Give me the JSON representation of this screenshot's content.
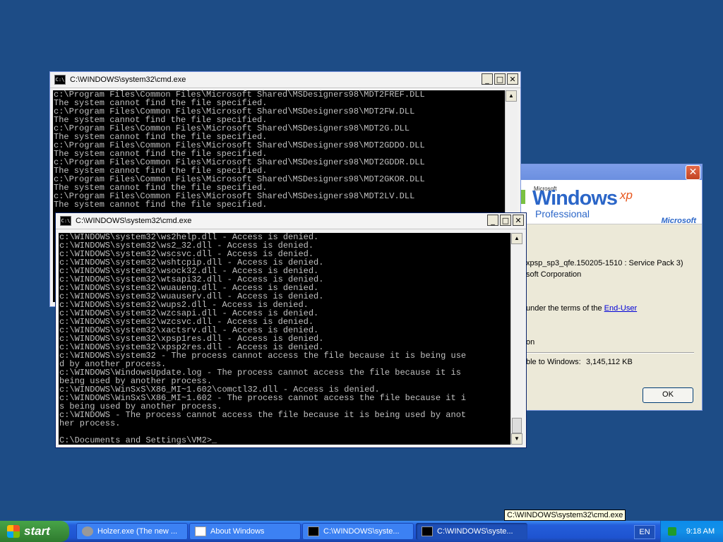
{
  "windows": {
    "cmd_back": {
      "title": "C:\\WINDOWS\\system32\\cmd.exe",
      "lines": [
        "c:\\Program Files\\Common Files\\Microsoft Shared\\MSDesigners98\\MDT2FREF.DLL",
        "The system cannot find the file specified.",
        "c:\\Program Files\\Common Files\\Microsoft Shared\\MSDesigners98\\MDT2FW.DLL",
        "The system cannot find the file specified.",
        "c:\\Program Files\\Common Files\\Microsoft Shared\\MSDesigners98\\MDT2G.DLL",
        "The system cannot find the file specified.",
        "c:\\Program Files\\Common Files\\Microsoft Shared\\MSDesigners98\\MDT2GDDO.DLL",
        "The system cannot find the file specified.",
        "c:\\Program Files\\Common Files\\Microsoft Shared\\MSDesigners98\\MDT2GDDR.DLL",
        "The system cannot find the file specified.",
        "c:\\Program Files\\Common Files\\Microsoft Shared\\MSDesigners98\\MDT2GKOR.DLL",
        "The system cannot find the file specified.",
        "c:\\Program Files\\Common Files\\Microsoft Shared\\MSDesigners98\\MDT2LV.DLL",
        "The system cannot find the file specified."
      ]
    },
    "cmd_front": {
      "title": "C:\\WINDOWS\\system32\\cmd.exe",
      "lines": [
        "c:\\WINDOWS\\system32\\ws2help.dll - Access is denied.",
        "c:\\WINDOWS\\system32\\ws2_32.dll - Access is denied.",
        "c:\\WINDOWS\\system32\\wscsvc.dll - Access is denied.",
        "c:\\WINDOWS\\system32\\wshtcpip.dll - Access is denied.",
        "c:\\WINDOWS\\system32\\wsock32.dll - Access is denied.",
        "c:\\WINDOWS\\system32\\wtsapi32.dll - Access is denied.",
        "c:\\WINDOWS\\system32\\wuaueng.dll - Access is denied.",
        "c:\\WINDOWS\\system32\\wuauserv.dll - Access is denied.",
        "c:\\WINDOWS\\system32\\wups2.dll - Access is denied.",
        "c:\\WINDOWS\\system32\\wzcsapi.dll - Access is denied.",
        "c:\\WINDOWS\\system32\\wzcsvc.dll - Access is denied.",
        "c:\\WINDOWS\\system32\\xactsrv.dll - Access is denied.",
        "c:\\WINDOWS\\system32\\xpsp1res.dll - Access is denied.",
        "c:\\WINDOWS\\system32\\xpsp2res.dll - Access is denied.",
        "c:\\WINDOWS\\system32 - The process cannot access the file because it is being use",
        "d by another process.",
        "c:\\WINDOWS\\WindowsUpdate.log - The process cannot access the file because it is",
        "being used by another process.",
        "c:\\WINDOWS\\WinSxS\\X86_MI~1.602\\comctl32.dll - Access is denied.",
        "c:\\WINDOWS\\WinSxS\\X86_MI~1.602 - The process cannot access the file because it i",
        "s being used by another process.",
        "c:\\WINDOWS - The process cannot access the file because it is being used by anot",
        "her process.",
        "",
        "C:\\Documents and Settings\\VM2>_"
      ]
    },
    "about": {
      "banner_ms": "Microsoft",
      "banner_windows": "Windows",
      "banner_xp": "xp",
      "banner_edition": "Professional",
      "banner_logo": "Microsoft",
      "version_line": "xpsp_sp3_qfe.150205-1510 : Service Pack 3)",
      "copyright_line": "soft Corporation",
      "license_prefix": "under the terms of the ",
      "license_link": "End-User",
      "owner_fragment": "on",
      "memory_label": "ble to Windows:",
      "memory_value": "3,145,112 KB",
      "ok_label": "OK"
    }
  },
  "tooltip": "C:\\WINDOWS\\system32\\cmd.exe",
  "taskbar": {
    "start_label": "start",
    "tasks": [
      {
        "label": "Holzer.exe (The new ..."
      },
      {
        "label": "About Windows"
      },
      {
        "label": "C:\\WINDOWS\\syste..."
      },
      {
        "label": "C:\\WINDOWS\\syste..."
      }
    ],
    "language": "EN",
    "clock": "9:18 AM"
  }
}
